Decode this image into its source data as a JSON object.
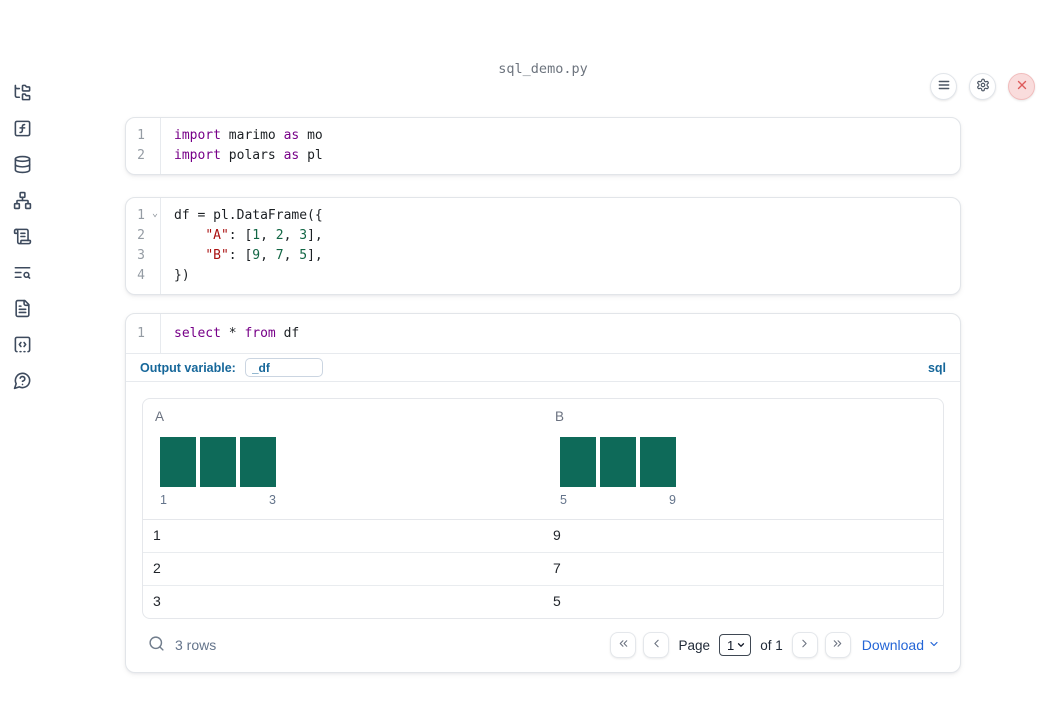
{
  "app": {
    "title": "sql_demo.py"
  },
  "colors": {
    "histogram_bar": "#0e6a59",
    "sql_accent_blue": "#16679a",
    "link_blue": "#2465d6",
    "danger_red": "#dd5b5b",
    "keyword": "#770088",
    "string": "#aa1111",
    "number": "#116644"
  },
  "topbar": {
    "buttons": [
      {
        "icon": "menu-icon",
        "name": "notebook-menu"
      },
      {
        "icon": "gear-icon",
        "name": "settings"
      },
      {
        "icon": "close-icon",
        "name": "shutdown"
      }
    ]
  },
  "sidebar": {
    "items": [
      {
        "icon": "file-tree-icon",
        "name": "file-explorer"
      },
      {
        "icon": "square-function-icon",
        "name": "variables"
      },
      {
        "icon": "database-icon",
        "name": "datasources"
      },
      {
        "icon": "network-icon",
        "name": "dependency-graph"
      },
      {
        "icon": "scroll-text-icon",
        "name": "logs"
      },
      {
        "icon": "text-search-icon",
        "name": "outline-search"
      },
      {
        "icon": "file-text-icon",
        "name": "documentation"
      },
      {
        "icon": "square-code-icon",
        "name": "snippets"
      },
      {
        "icon": "help-bubble-icon",
        "name": "help"
      }
    ]
  },
  "cells": [
    {
      "lines": [
        {
          "n": "1",
          "t": [
            [
              "import",
              "kw"
            ],
            [
              " marimo ",
              "pl"
            ],
            [
              "as",
              "kw"
            ],
            [
              " mo",
              "pl"
            ]
          ]
        },
        {
          "n": "2",
          "t": [
            [
              "import",
              "kw"
            ],
            [
              " polars ",
              "pl"
            ],
            [
              "as",
              "kw"
            ],
            [
              " pl",
              "pl"
            ]
          ]
        }
      ]
    },
    {
      "lines": [
        {
          "n": "1",
          "fold": true,
          "t": [
            [
              "df = pl.DataFrame({",
              "pl"
            ]
          ]
        },
        {
          "n": "2",
          "t": [
            [
              "    ",
              "pl"
            ],
            [
              "\"A\"",
              "str"
            ],
            [
              ": [",
              "pl"
            ],
            [
              "1",
              "num"
            ],
            [
              ", ",
              "pl"
            ],
            [
              "2",
              "num"
            ],
            [
              ", ",
              "pl"
            ],
            [
              "3",
              "num"
            ],
            [
              "],",
              "pl"
            ]
          ]
        },
        {
          "n": "3",
          "t": [
            [
              "    ",
              "pl"
            ],
            [
              "\"B\"",
              "str"
            ],
            [
              ": [",
              "pl"
            ],
            [
              "9",
              "num"
            ],
            [
              ", ",
              "pl"
            ],
            [
              "7",
              "num"
            ],
            [
              ", ",
              "pl"
            ],
            [
              "5",
              "num"
            ],
            [
              "],",
              "pl"
            ]
          ]
        },
        {
          "n": "4",
          "t": [
            [
              "})",
              "pl"
            ]
          ]
        }
      ]
    }
  ],
  "sql_cell": {
    "lines": [
      {
        "n": "1",
        "t": [
          [
            "select",
            "kw"
          ],
          [
            " * ",
            "pl"
          ],
          [
            "from",
            "kw"
          ],
          [
            " df",
            "pl"
          ]
        ]
      }
    ],
    "output_variable_label": "Output variable:",
    "output_variable_value": "_df",
    "language_badge": "sql"
  },
  "table": {
    "columns": [
      {
        "name": "A",
        "min_label": "1",
        "max_label": "3",
        "bars": [
          1,
          1,
          1
        ]
      },
      {
        "name": "B",
        "min_label": "5",
        "max_label": "9",
        "bars": [
          1,
          1,
          1
        ]
      }
    ],
    "rows": [
      [
        "1",
        "9"
      ],
      [
        "2",
        "7"
      ],
      [
        "3",
        "5"
      ]
    ],
    "footer": {
      "row_count": "3 rows",
      "page_label": "Page",
      "page_value": "1",
      "of_label": "of 1",
      "download_label": "Download"
    }
  }
}
